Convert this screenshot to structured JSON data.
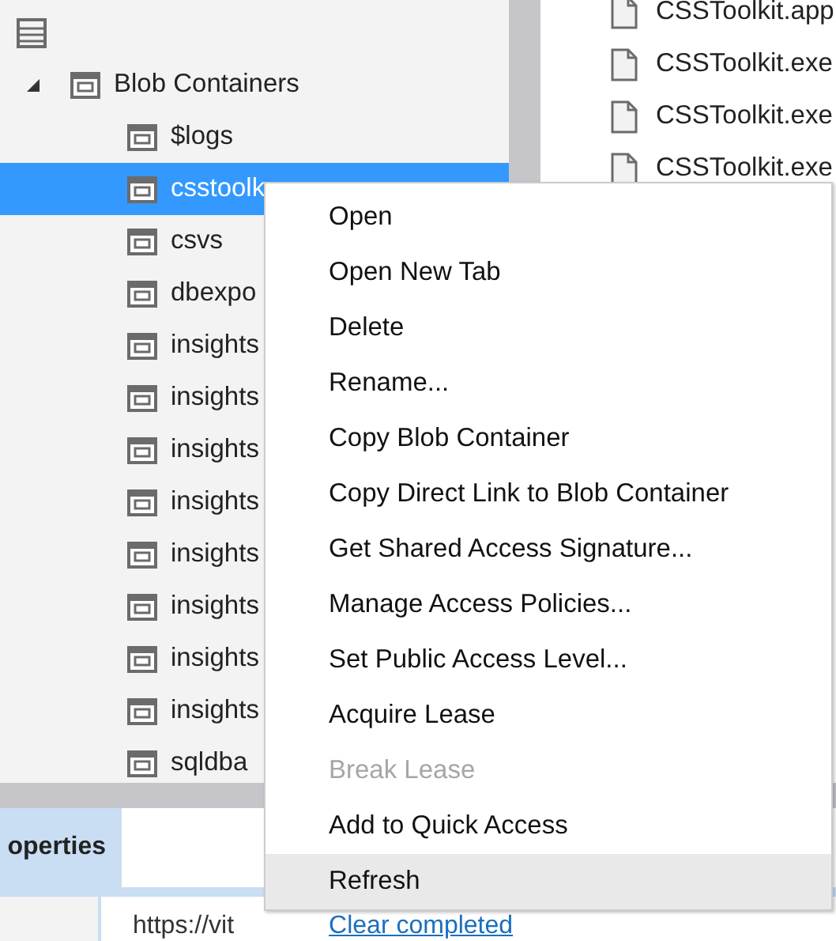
{
  "tree": {
    "items": [
      {
        "label": "Blob Containers",
        "expanded": true,
        "selected": false,
        "children": [
          {
            "label": "$logs",
            "selected": false
          },
          {
            "label": "csstoolk",
            "selected": true
          },
          {
            "label": "csvs",
            "selected": false
          },
          {
            "label": "dbexpo",
            "selected": false
          },
          {
            "label": "insights",
            "selected": false
          },
          {
            "label": "insights",
            "selected": false
          },
          {
            "label": "insights",
            "selected": false
          },
          {
            "label": "insights",
            "selected": false
          },
          {
            "label": "insights",
            "selected": false
          },
          {
            "label": "insights",
            "selected": false
          },
          {
            "label": "insights",
            "selected": false
          },
          {
            "label": "insights",
            "selected": false
          },
          {
            "label": "sqldba",
            "selected": false
          }
        ]
      }
    ]
  },
  "file_list": [
    {
      "name": "CSSToolkit.app"
    },
    {
      "name": "CSSToolkit.exe"
    },
    {
      "name": "CSSToolkit.exe"
    },
    {
      "name": "CSSToolkit.exe"
    }
  ],
  "bottom_panel": {
    "tabs": [
      {
        "label": "operties",
        "selected": true
      }
    ],
    "url": "https://vit",
    "link": "Clear completed"
  },
  "context_menu": {
    "items": [
      {
        "label": "Open",
        "disabled": false,
        "highlighted": false
      },
      {
        "label": "Open New Tab",
        "disabled": false,
        "highlighted": false
      },
      {
        "label": "Delete",
        "disabled": false,
        "highlighted": false
      },
      {
        "label": "Rename...",
        "disabled": false,
        "highlighted": false
      },
      {
        "label": "Copy Blob Container",
        "disabled": false,
        "highlighted": false
      },
      {
        "label": "Copy Direct Link to Blob Container",
        "disabled": false,
        "highlighted": false
      },
      {
        "label": "Get Shared Access Signature...",
        "disabled": false,
        "highlighted": false
      },
      {
        "label": "Manage Access Policies...",
        "disabled": false,
        "highlighted": false
      },
      {
        "label": "Set Public Access Level...",
        "disabled": false,
        "highlighted": false
      },
      {
        "label": "Acquire Lease",
        "disabled": false,
        "highlighted": false
      },
      {
        "label": "Break Lease",
        "disabled": true,
        "highlighted": false
      },
      {
        "label": "Add to Quick Access",
        "disabled": false,
        "highlighted": false
      },
      {
        "label": "Refresh",
        "disabled": false,
        "highlighted": true
      }
    ]
  }
}
